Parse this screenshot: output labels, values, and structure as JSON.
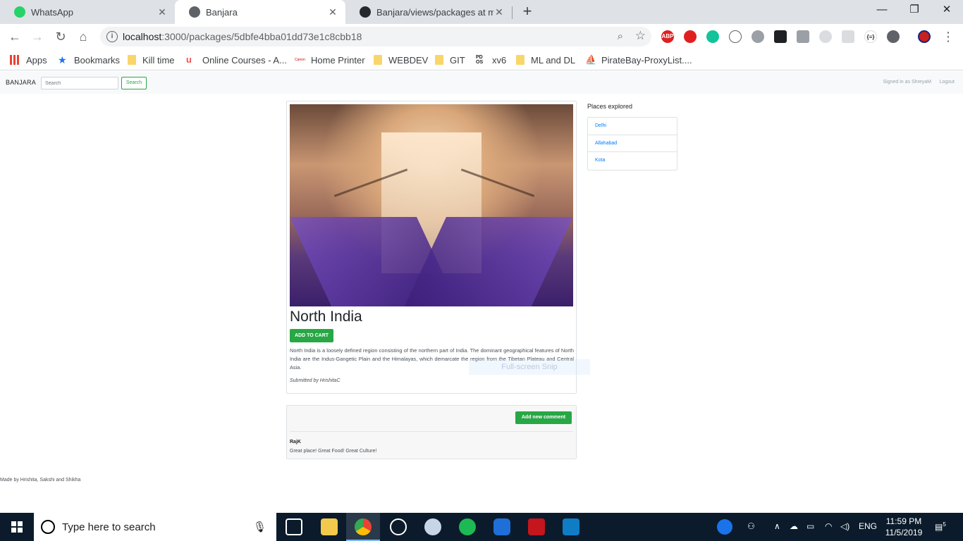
{
  "browser": {
    "tabs": [
      {
        "title": "WhatsApp",
        "icon": "whatsapp-icon"
      },
      {
        "title": "Banjara",
        "icon": "globe-icon"
      },
      {
        "title": "Banjara/views/packages at maste",
        "icon": "github-icon"
      }
    ],
    "url_host": "localhost",
    "url_path": ":3000/packages/5dbfe4bba01dd73e1c8cbb18",
    "bookmarks": [
      "Apps",
      "Bookmarks",
      "Kill time",
      "Online Courses - A...",
      "Home Printer",
      "WEBDEV",
      "GIT",
      "xv6",
      "ML and DL",
      "PirateBay-ProxyList...."
    ],
    "extensions": [
      "ABP"
    ]
  },
  "navbar": {
    "brand": "BANJARA",
    "search_placeholder": "Search",
    "search_button": "Search",
    "signed_in": "Signed in as ShreyaM",
    "logout": "Logout"
  },
  "package": {
    "title": "North India",
    "add_to_cart": "ADD TO CART",
    "description": "North India is a loosely defined region consisting of the northern part of India. The dominant geographical features of North India are the Indus-Gangetic Plain and the Himalayas, which demarcate the region from the Tibetan Plateau and Central Asia.",
    "submitted_by": "Submitted by HrishitaC"
  },
  "overlay": {
    "snip_label": "Full-screen Snip"
  },
  "comments": {
    "add_button": "Add new comment",
    "items": [
      {
        "author": "RajK",
        "text": "Great place! Great Food! Great Culture!"
      }
    ]
  },
  "places": {
    "heading": "Places explored",
    "items": [
      "Delhi",
      "Allahabad",
      "Kota"
    ]
  },
  "footer": {
    "text": "Made by Hrishita, Sakshi and Shikha"
  },
  "taskbar": {
    "search_placeholder": "Type here to search",
    "language": "ENG",
    "time": "11:59 PM",
    "date": "11/5/2019",
    "notifications": "5"
  },
  "colors": {
    "accent_green": "#28a745",
    "link_blue": "#007bff",
    "taskbar": "#0b1b2b"
  }
}
